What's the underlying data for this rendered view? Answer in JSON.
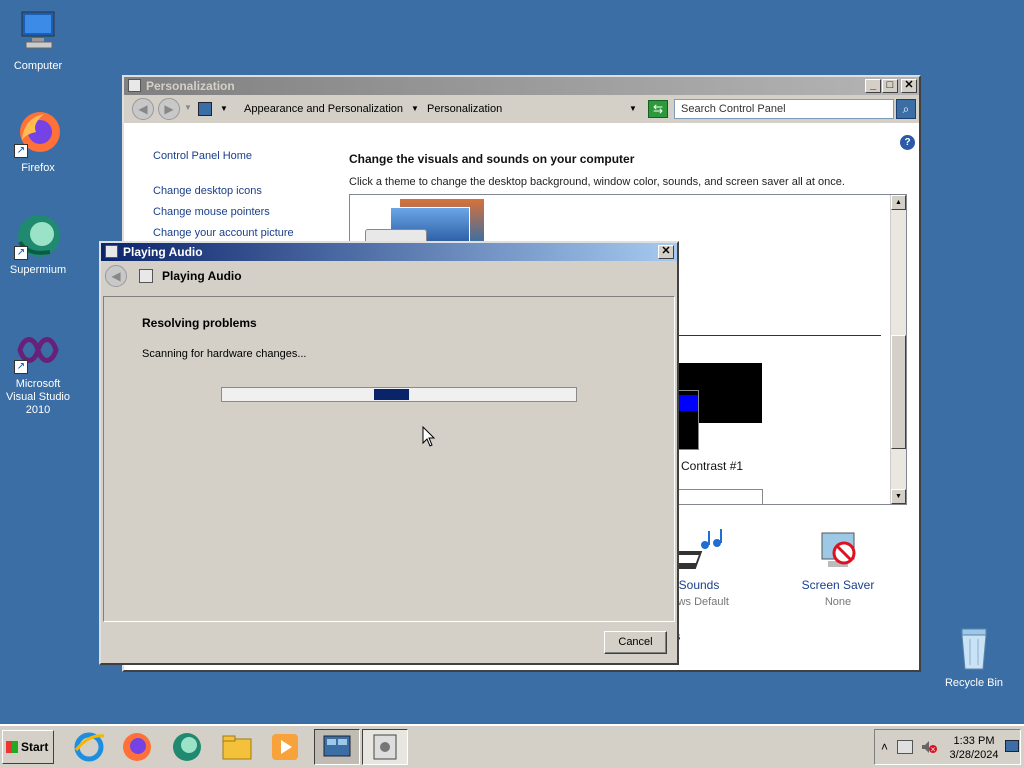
{
  "desktop": {
    "icons": [
      {
        "label": "Computer"
      },
      {
        "label": "Firefox"
      },
      {
        "label": "Supermium"
      },
      {
        "label": "Microsoft Visual Studio 2010"
      },
      {
        "label": "Recycle Bin"
      }
    ]
  },
  "personalization": {
    "title": "Personalization",
    "breadcrumb": [
      "Appearance and Personalization",
      "Personalization"
    ],
    "search_placeholder": "Search Control Panel",
    "links": [
      "Control Panel Home",
      "Change desktop icons",
      "Change mouse pointers",
      "Change your account picture"
    ],
    "heading": "Change the visuals and sounds on your computer",
    "subheading": "Click a theme to change the desktop background, window color, sounds, and screen saver all at once.",
    "theme_name_partial": "n Contrast #1",
    "bottom_items": [
      {
        "label": "Sounds",
        "value": "lows Default"
      },
      {
        "label": "Screen Saver",
        "value": "None"
      }
    ],
    "help_symbol": "?",
    "partial_link": "s"
  },
  "dialog": {
    "title": "Playing Audio",
    "nav_title": "Playing Audio",
    "status_heading": "Resolving problems",
    "status_text": "Scanning for hardware changes...",
    "progress_marquee": 0.1,
    "cancel_label": "Cancel",
    "close_symbol": "✕"
  },
  "taskbar": {
    "start_label": "Start",
    "time": "1:33 PM",
    "date": "3/28/2024",
    "tray_expand": "˄"
  }
}
